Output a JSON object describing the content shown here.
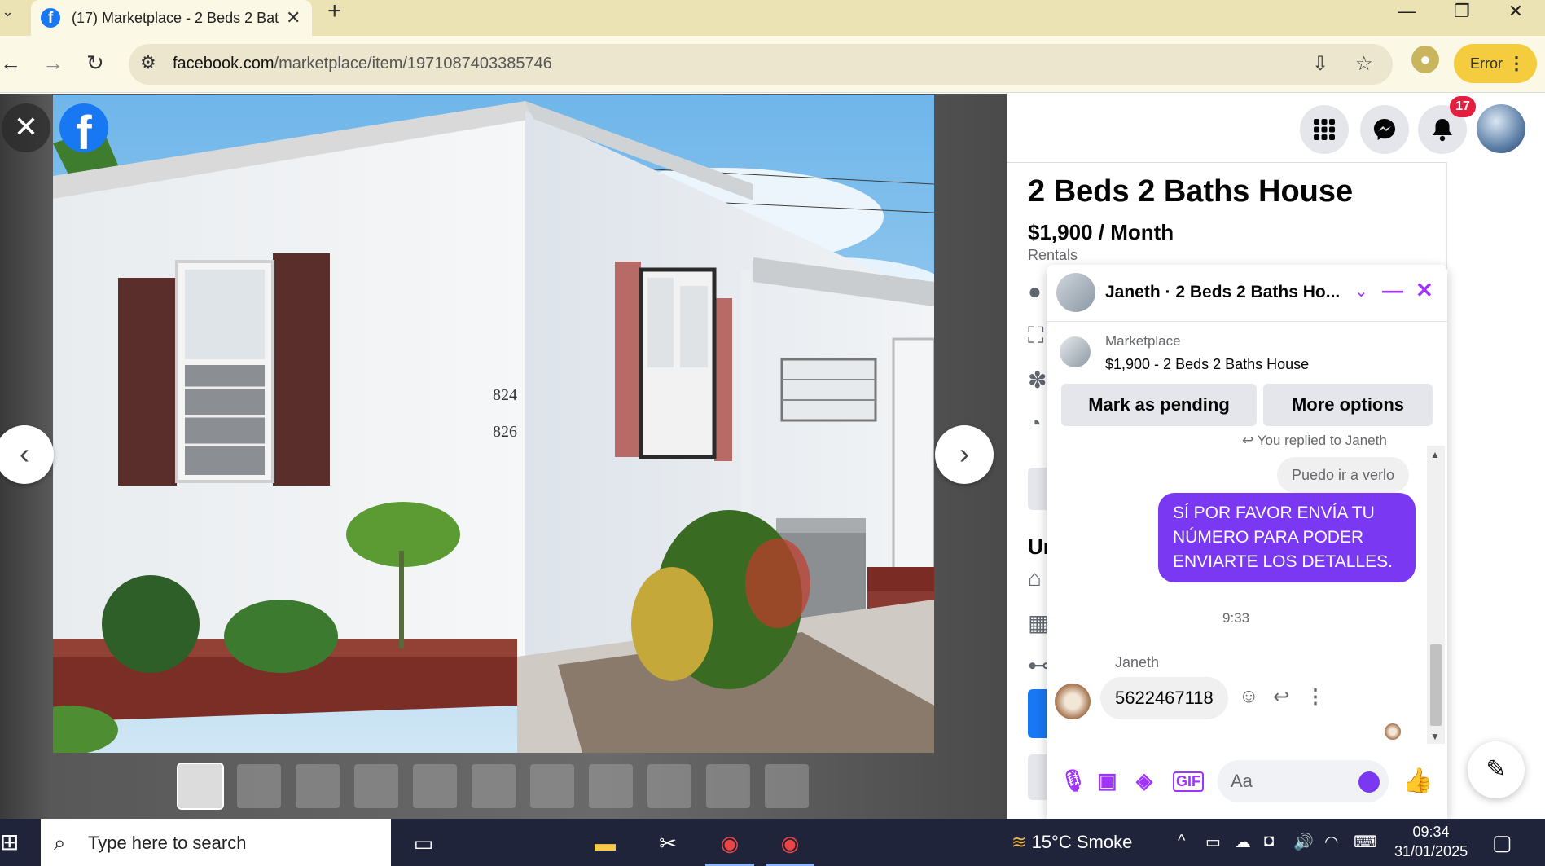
{
  "browser": {
    "tab_title": "(17) Marketplace - 2 Beds 2 Bat",
    "tab_favicon": "f",
    "tab_close": "✕",
    "new_tab": "+",
    "url_host": "facebook.com",
    "url_path": "/marketplace/item/1971087403385746",
    "error_label": "Error",
    "window_minimize": "—",
    "window_restore": "❐",
    "window_close": "✕"
  },
  "viewer": {
    "close_glyph": "✕",
    "logo_glyph": "f",
    "prev_glyph": "‹",
    "next_glyph": "›",
    "house_numbers": [
      "824",
      "826"
    ],
    "thumbnail_count": 11,
    "active_thumbnail": 1
  },
  "header": {
    "notification_count": "17"
  },
  "listing": {
    "title": "2 Beds 2 Baths House",
    "price": "$1,900 / Month",
    "category": "Rentals",
    "partial_heading": "Ur"
  },
  "chat": {
    "title": "Janeth · 2 Beds 2 Baths Ho...",
    "marketplace_label": "Marketplace",
    "marketplace_item": "$1,900 - 2 Beds 2 Baths House",
    "mark_pending_label": "Mark as pending",
    "more_options_label": "More options",
    "replied_note": "You replied to Janeth",
    "quoted_message": "Puedo ir a verlo",
    "outgoing_message": "SÍ POR FAVOR ENVÍA TU NÚMERO PARA PODER ENVIARTE LOS DETALLES.",
    "timestamp": "9:33",
    "sender_name": "Janeth",
    "incoming_message": "5622467118",
    "composer_placeholder": "Aa"
  },
  "taskbar": {
    "search_placeholder": "Type here to search",
    "weather": "15°C  Smoke",
    "time": "09:34",
    "date": "31/01/2025"
  },
  "colors": {
    "facebook_blue": "#1877f2",
    "messenger_purple": "#7b38f2",
    "badge_red": "#e41e3f",
    "chrome_tab_bar": "#ebe3b4",
    "error_button": "#f4cc3e"
  }
}
